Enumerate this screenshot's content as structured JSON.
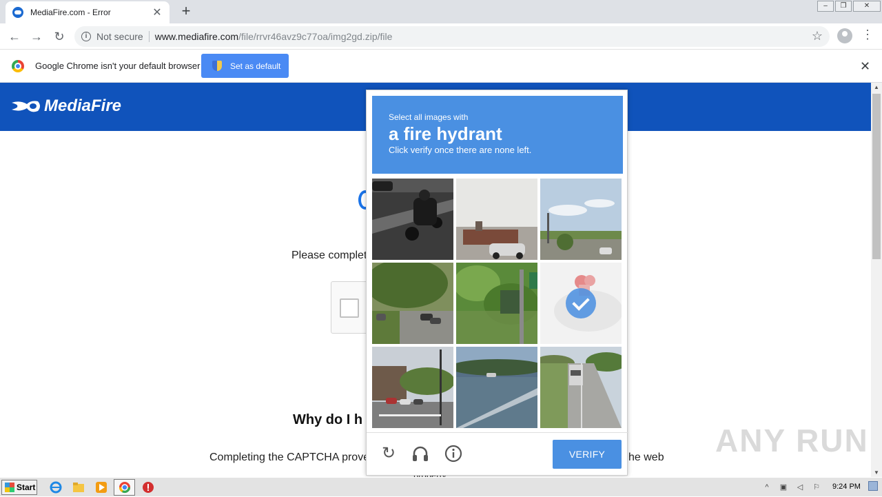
{
  "browser": {
    "tab_title": "MediaFire.com - Error",
    "new_tab": "+",
    "tab_close": "✕",
    "security_label": "Not secure",
    "url_host": "www.mediafire.com",
    "url_path": "/file/rrvr46avz9c77oa/img2gd.zip/file",
    "back": "←",
    "forward": "→",
    "reload": "↻",
    "star": "☆",
    "menu": "⋮"
  },
  "infobar": {
    "message": "Google Chrome isn't your default browser",
    "button": "Set as default",
    "close": "✕"
  },
  "page": {
    "logo_text": "MediaFire",
    "please_complete": "Please complet",
    "why_heading": "Why do I h",
    "completing": "Completing the CAPTCHA prove",
    "web_tail": "he web",
    "cut_line": "property."
  },
  "captcha": {
    "prompt_small": "Select all images with",
    "prompt_big": "a fire hydrant",
    "prompt_hint": "Click verify once there are none left.",
    "verify_label": "VERIFY",
    "tiles": [
      {
        "scene": "motorcycle-road",
        "selected": false
      },
      {
        "scene": "street-car-building",
        "selected": false
      },
      {
        "scene": "road-sky-trees",
        "selected": false
      },
      {
        "scene": "tree-lined-street",
        "selected": false
      },
      {
        "scene": "fence-sign-trees",
        "selected": false
      },
      {
        "scene": "fire-hydrant-faded",
        "selected": true
      },
      {
        "scene": "street-lamp-cars",
        "selected": false
      },
      {
        "scene": "grass-road",
        "selected": false
      },
      {
        "scene": "highway-truck",
        "selected": false
      }
    ]
  },
  "watermark": "ANY RUN",
  "taskbar": {
    "start": "Start",
    "clock": "9:24 PM"
  },
  "colors": {
    "mediafire_blue": "#1053bb",
    "captcha_blue": "#4a90e2",
    "chrome_button": "#4a8af4"
  }
}
